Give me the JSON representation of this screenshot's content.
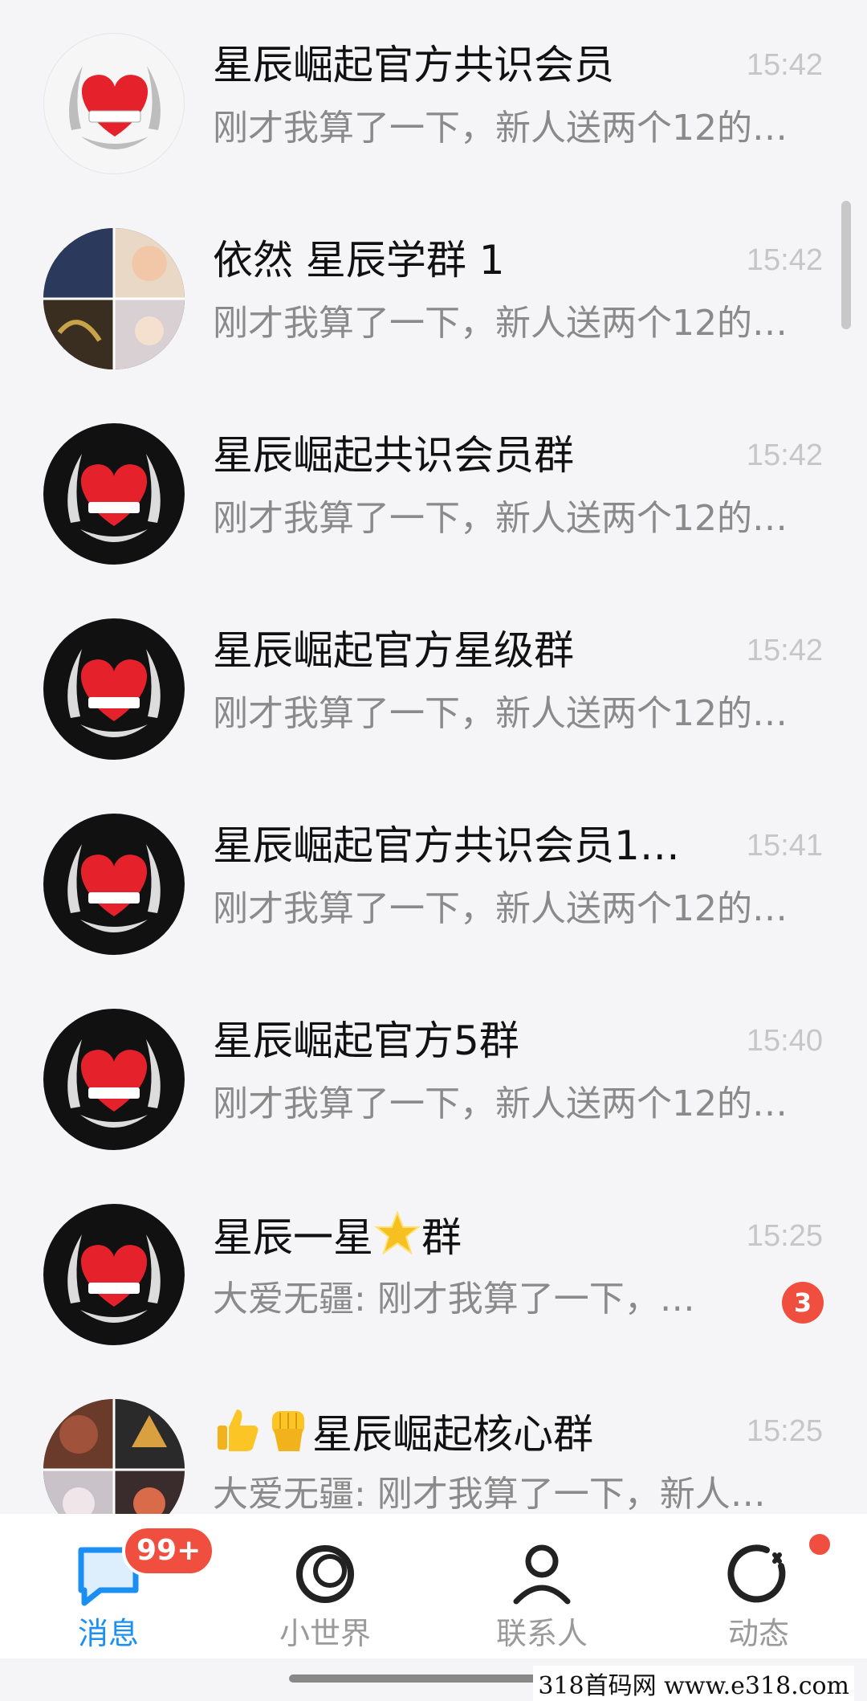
{
  "conversations": [
    {
      "title": "星辰崛起官方共识会员",
      "time": "15:42",
      "preview": "刚才我算了一下，新人送两个12的…",
      "avatar": "heart-laurel-light"
    },
    {
      "title": "依然  星辰学群 1",
      "time": "15:42",
      "preview": "刚才我算了一下，新人送两个12的…",
      "avatar": "photo-collage"
    },
    {
      "title": "星辰崛起共识会员群",
      "time": "15:42",
      "preview": "刚才我算了一下，新人送两个12的…",
      "avatar": "heart-laurel-dark"
    },
    {
      "title": "星辰崛起官方星级群",
      "time": "15:42",
      "preview": "刚才我算了一下，新人送两个12的…",
      "avatar": "heart-laurel-dark"
    },
    {
      "title": "星辰崛起官方共识会员1…",
      "time": "15:41",
      "preview": "刚才我算了一下，新人送两个12的…",
      "avatar": "heart-laurel-dark"
    },
    {
      "title": "星辰崛起官方5群",
      "time": "15:40",
      "preview": "刚才我算了一下，新人送两个12的…",
      "avatar": "heart-laurel-dark"
    },
    {
      "title_prefix": "星辰一星",
      "title_suffix": "群",
      "title_emoji": "star-icon",
      "time": "15:25",
      "preview": "大爱无疆: 刚才我算了一下，…",
      "unread": "3",
      "avatar": "heart-laurel-dark"
    },
    {
      "title_emoji": "thumbs-up-icon fist-icon",
      "title": "星辰崛起核心群",
      "time": "15:25",
      "preview": "大爱无疆: 刚才我算了一下，新人…",
      "avatar": "photo-collage"
    }
  ],
  "tabs": [
    {
      "label": "消息",
      "icon": "chat-bubble-icon",
      "badge": "99+",
      "active": true
    },
    {
      "label": "小世界",
      "icon": "world-ring-icon"
    },
    {
      "label": "联系人",
      "icon": "person-icon"
    },
    {
      "label": "动态",
      "icon": "star-spin-icon",
      "dot": true
    }
  ],
  "watermark": "318首码网  www.e318.com",
  "colors": {
    "accent": "#1c8ff2",
    "badge": "#f04e3e",
    "background": "#f5f5f7"
  }
}
